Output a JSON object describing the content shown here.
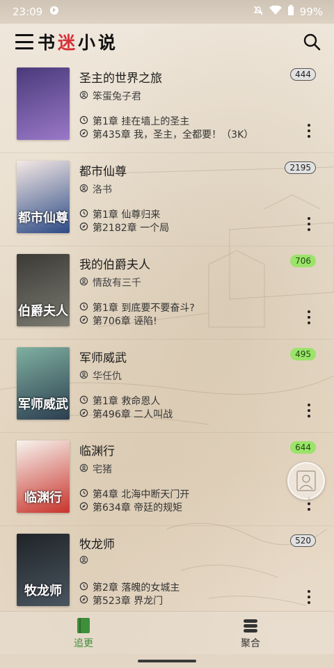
{
  "status_bar": {
    "time": "23:09",
    "battery": "99%"
  },
  "app": {
    "title_part1": "书",
    "title_part2": "迷",
    "title_part3": "小说"
  },
  "books": [
    {
      "name": "圣主的世界之旅",
      "author": "笨蛋兔子君",
      "read_chapter": "第1章 挂在墙上的圣主",
      "latest_chapter": "第435章 我，圣主，全都要！（3K）",
      "badge": "444",
      "badge_style": "grey",
      "cover_title": "",
      "cover_colors": [
        "#4a3a7a",
        "#9a78c8"
      ]
    },
    {
      "name": "都市仙尊",
      "author": "洛书",
      "read_chapter": "第1章 仙尊归来",
      "latest_chapter": "第2182章 一个局",
      "badge": "2195",
      "badge_style": "grey",
      "cover_title": "都市仙尊",
      "cover_colors": [
        "#f4e8e4",
        "#2d4b86"
      ]
    },
    {
      "name": "我的伯爵夫人",
      "author": "情敌有三千",
      "read_chapter": "第1章 到底要不要奋斗?",
      "latest_chapter": "第706章 诬陷!",
      "badge": "706",
      "badge_style": "green",
      "cover_title": "伯爵夫人",
      "cover_colors": [
        "#3b3a36",
        "#7b7a70"
      ]
    },
    {
      "name": "军师威武",
      "author": "华任仇",
      "read_chapter": "第1章 救命恩人",
      "latest_chapter": "第496章 二人叫战",
      "badge": "495",
      "badge_style": "green",
      "cover_title": "军师威武",
      "cover_colors": [
        "#7fb0a0",
        "#2c3e50"
      ]
    },
    {
      "name": "临渊行",
      "author": "宅猪",
      "read_chapter": "第4章 北海中断天门开",
      "latest_chapter": "第634章 帝廷的规矩",
      "badge": "644",
      "badge_style": "green",
      "cover_title": "临渊行",
      "cover_colors": [
        "#f7f4ef",
        "#c8342c"
      ]
    },
    {
      "name": "牧龙师",
      "author": "",
      "read_chapter": "第2章 落魄的女城主",
      "latest_chapter": "第523章 界龙门",
      "badge": "520",
      "badge_style": "grey",
      "cover_title": "牧龙师",
      "cover_colors": [
        "#1f2428",
        "#4a5560"
      ]
    }
  ],
  "bottom_nav": {
    "tab1": "追更",
    "tab2": "聚合"
  },
  "colors": {
    "accent_red": "#d6303a",
    "accent_green": "#3f8e3a",
    "badge_green": "#9be36a"
  }
}
